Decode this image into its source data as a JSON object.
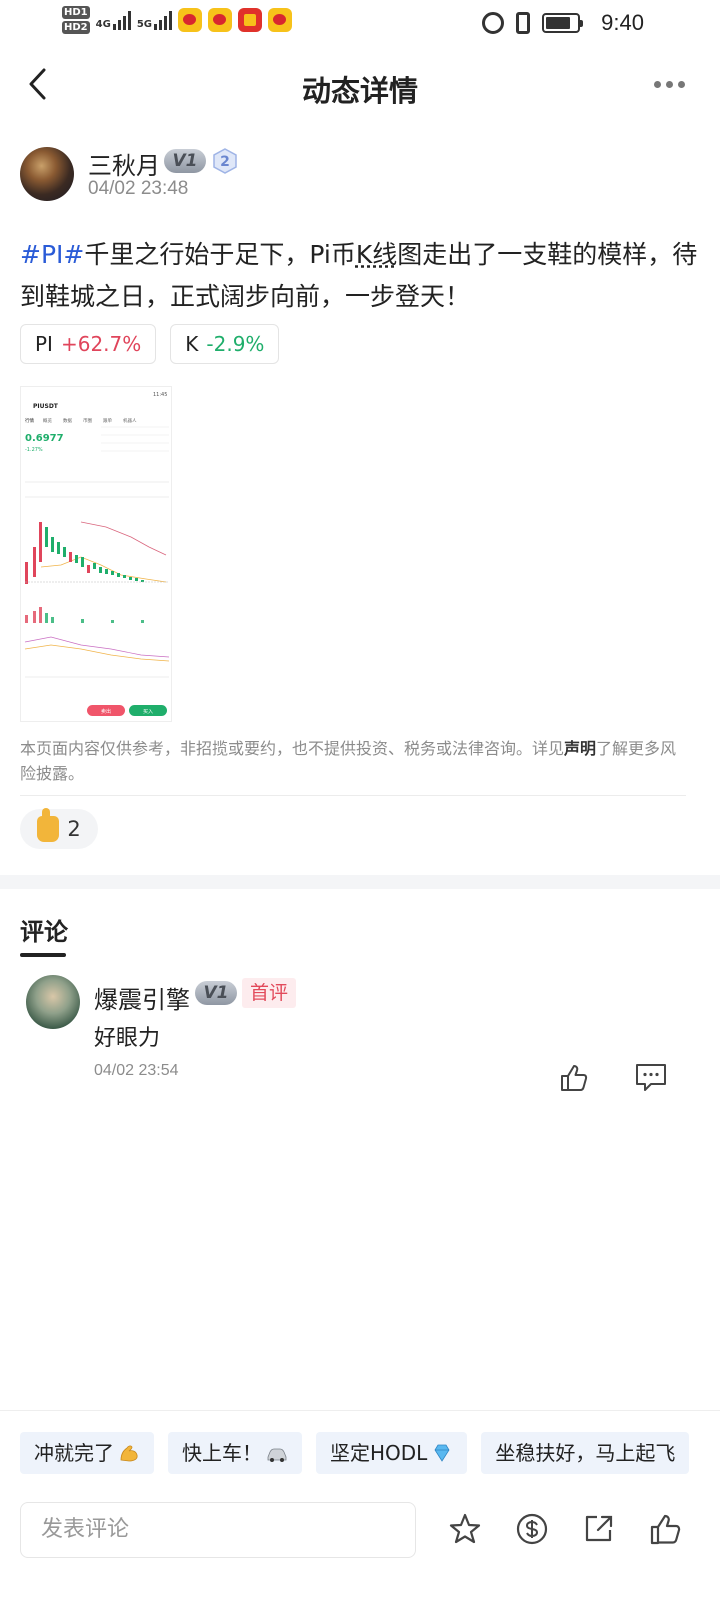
{
  "status_bar": {
    "time": "9:40",
    "sim1": "HD1",
    "sim2": "HD2",
    "net1": "4G",
    "net2": "5G"
  },
  "header": {
    "title": "动态详情"
  },
  "post": {
    "author": {
      "name": "三秋月",
      "vip": "V1",
      "level": "2",
      "time": "04/02 23:48"
    },
    "text_parts": {
      "hashtag": "#PI#",
      "before_k": "千里之行始于足下，Pi币",
      "kline": "K线",
      "after_k": "图走出了一支鞋的模样，待到鞋城之日，正式阔步向前，一步登天！"
    },
    "tickers": [
      {
        "symbol": "PI",
        "change": "+62.7%"
      },
      {
        "symbol": "K",
        "change": "-2.9%"
      }
    ],
    "screenshot": {
      "time": "11:45",
      "pair": "PIUSDT",
      "price": "0.6977",
      "change": "-1.27%",
      "tabs": [
        "行情",
        "概览",
        "数据",
        "币圈",
        "跟单",
        "机器人"
      ],
      "sell": "卖出",
      "buy": "买入"
    },
    "disclaimer": {
      "before": "本页面内容仅供参考，非招揽或要约，也不提供投资、税务或法律咨询。详见",
      "link": "声明",
      "after": "了解更多风险披露。"
    },
    "likes": "2"
  },
  "comments": {
    "heading": "评论",
    "items": [
      {
        "name": "爆震引擎",
        "vip": "V1",
        "badge": "首评",
        "text": "好眼力",
        "time": "04/02 23:54"
      }
    ]
  },
  "quick_replies": [
    {
      "label": "冲就完了",
      "emoji": "muscle"
    },
    {
      "label": "快上车！",
      "emoji": "car"
    },
    {
      "label": "坚定HODL",
      "emoji": "diamond"
    },
    {
      "label": "坐稳扶好，马上起飞",
      "emoji": ""
    }
  ],
  "bottom_bar": {
    "placeholder": "发表评论",
    "icons": [
      "star-icon",
      "coin-icon",
      "share-icon",
      "thumbs-up-icon"
    ]
  }
}
